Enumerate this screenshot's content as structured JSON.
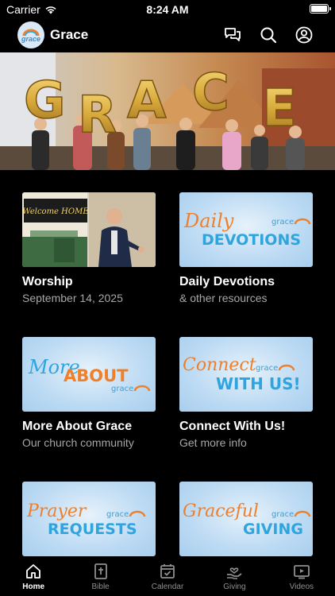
{
  "status": {
    "carrier": "Carrier",
    "time": "8:24 AM",
    "battery_level": 1.0
  },
  "header": {
    "logo_text": "grace",
    "title": "Grace",
    "icons": [
      "chat-icon",
      "search-icon",
      "profile-icon"
    ]
  },
  "banner": {
    "letters": [
      "G",
      "R",
      "A",
      "C",
      "E"
    ]
  },
  "cards": [
    {
      "title": "Worship",
      "subtitle": "September 14, 2025",
      "image": "worship-video-thumbnail",
      "sign_text": "Welcome HOME"
    },
    {
      "title": "Daily Devotions",
      "subtitle": "& other resources",
      "image": {
        "script": "Daily",
        "bold": "DEVOTIONS",
        "logo": "grace"
      }
    },
    {
      "title": "More About Grace",
      "subtitle": "Our church community",
      "image": {
        "script": "More",
        "bold": "ABOUT",
        "logo": "grace"
      }
    },
    {
      "title": "Connect With Us!",
      "subtitle": "Get more info",
      "image": {
        "script": "Connect",
        "bold": "WITH US!",
        "logo": "grace"
      }
    },
    {
      "title": "",
      "subtitle": "",
      "image": {
        "script": "Prayer",
        "bold": "REQUESTS",
        "logo": "grace"
      }
    },
    {
      "title": "",
      "subtitle": "",
      "image": {
        "script": "Graceful",
        "bold": "GIVING",
        "logo": "grace"
      }
    }
  ],
  "tabs": [
    {
      "label": "Home",
      "icon": "home-icon",
      "active": true
    },
    {
      "label": "Bible",
      "icon": "bible-icon",
      "active": false
    },
    {
      "label": "Calendar",
      "icon": "calendar-icon",
      "active": false
    },
    {
      "label": "Giving",
      "icon": "giving-icon",
      "active": false
    },
    {
      "label": "Videos",
      "icon": "videos-icon",
      "active": false
    }
  ],
  "colors": {
    "background": "#000000",
    "accent_orange": "#f07f2a",
    "accent_blue": "#2fa5e0",
    "tab_inactive": "#8f8f8f"
  }
}
